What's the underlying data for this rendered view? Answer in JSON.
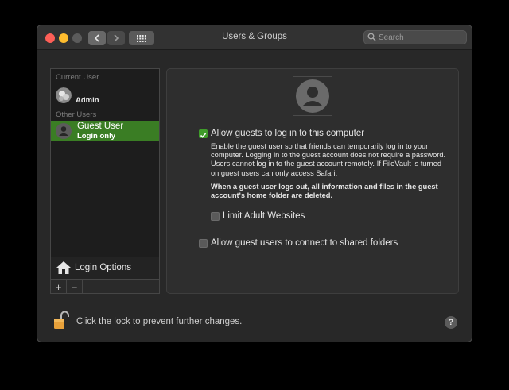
{
  "window": {
    "title": "Users & Groups"
  },
  "toolbar": {
    "search_placeholder": "Search"
  },
  "sidebar": {
    "current_user_header": "Current User",
    "current_user": {
      "name": "Admin"
    },
    "other_users_header": "Other Users",
    "other_users": [
      {
        "name": "Guest User",
        "subtitle": "Login only",
        "selected": true
      }
    ],
    "login_options_label": "Login Options",
    "add_label": "+",
    "remove_label": "−"
  },
  "detail": {
    "allow_guests_label": "Allow guests to log in to this computer",
    "allow_guests_checked": true,
    "description": "Enable the guest user so that friends can temporarily log in to your computer. Logging in to the guest account does not require a password. Users cannot log in to the guest account remotely. If FileVault is turned on guest users can only access Safari.",
    "warning": "When a guest user logs out, all information and files in the guest account's home folder are deleted.",
    "limit_adult_label": "Limit Adult Websites",
    "limit_adult_checked": false,
    "shared_folders_label": "Allow guest users to connect to shared folders",
    "shared_folders_checked": false
  },
  "footer": {
    "lock_text": "Click the lock to prevent further changes.",
    "help_label": "?"
  },
  "colors": {
    "selection": "#3a7d24",
    "checkbox_on": "#3f9c2a",
    "lock": "#e8a13a"
  }
}
